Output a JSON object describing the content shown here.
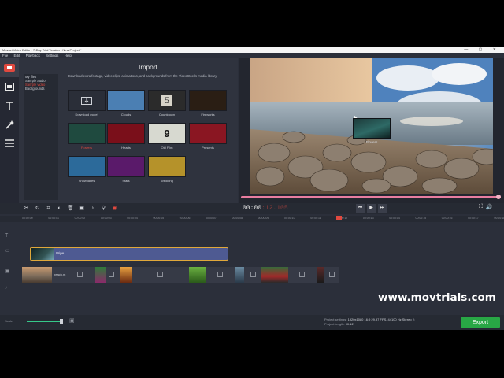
{
  "window": {
    "title": "Movavi Video Editor - 7-Day Trial Version - New Project *"
  },
  "menu": [
    "File",
    "Edit",
    "Playback",
    "Settings",
    "Help"
  ],
  "categories": [
    "My files",
    "Sample audio",
    "Sample video",
    "Backgrounds"
  ],
  "import": {
    "title": "Import",
    "description": "Download extra footage, video clips, animations, and backgrounds from the VideoStocks media library!",
    "tiles": [
      {
        "caption": "Download more!",
        "color": "#2a2e38"
      },
      {
        "caption": "Clouds",
        "color": "#4b7fb3"
      },
      {
        "caption": "Countdown",
        "color": "#2b2b2b"
      },
      {
        "caption": "Fireworks",
        "color": "#2a1e14"
      },
      {
        "caption": "Flowers",
        "color": "#1f4a3f",
        "selected": true
      },
      {
        "caption": "Hearts",
        "color": "#7a0f1a"
      },
      {
        "caption": "Old Film",
        "color": "#d7d9d0"
      },
      {
        "caption": "Presents",
        "color": "#8a1622"
      },
      {
        "caption": "Snowflakes",
        "color": "#2c6a9a"
      },
      {
        "caption": "Stars",
        "color": "#5a1a6a"
      },
      {
        "caption": "Wedding",
        "color": "#b5922a"
      }
    ],
    "countdown_digit": "5",
    "oldfilm_digit": "9"
  },
  "preview": {
    "timecode_main": "00:00",
    "timecode_rest": ":12.105",
    "progress": 1.0
  },
  "timeline": {
    "ruler": [
      "00:00:00",
      "00:00:01",
      "00:00:02",
      "00:00:03",
      "00:00:04",
      "00:00:05",
      "00:00:06",
      "00:00:07",
      "00:00:08",
      "00:00:09",
      "00:00:10",
      "00:00:11",
      "00:00:12",
      "00:00:13",
      "00:00:14",
      "00:00:15",
      "00:00:16",
      "00:00:17",
      "00:00:18"
    ],
    "fx_clip_label": "Wipe",
    "first_clip_label": "beach.m",
    "dragged_clip_caption": "Flowers"
  },
  "watermark": "www.movtrials.com",
  "status": {
    "scale_label": "Scale:",
    "scale_value": 1.0,
    "project_settings_label": "Project settings:",
    "project_settings_value": "1920x1080 16:9 29.97 FPS, 44100 Hz Stereo",
    "project_length_label": "Project length:",
    "project_length_value": "00:12"
  },
  "buttons": {
    "export": "Export"
  },
  "colors": {
    "accent_red": "#e0493f",
    "export_green": "#28a745",
    "fx_clip": "#4e5a92"
  }
}
